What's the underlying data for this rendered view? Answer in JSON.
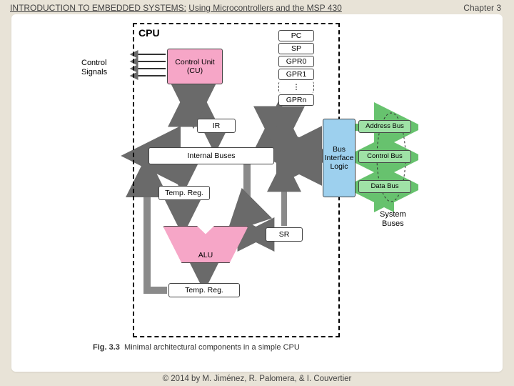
{
  "header": {
    "title_left": "INTRODUCTION TO EMBEDDED SYSTEMS:",
    "title_right": "Using Microcontrollers and the MSP 430",
    "chapter": "Chapter 3"
  },
  "footer": {
    "copyright": "© 2014 by M. Jiménez, R. Palomera, & I. Couvertier"
  },
  "caption": {
    "fig_label": "Fig. 3.3",
    "text": "Minimal architectural components in a simple CPU"
  },
  "labels": {
    "cpu": "CPU",
    "control_signals_l1": "Control",
    "control_signals_l2": "Signals",
    "cu_l1": "Control Unit",
    "cu_l2": "(CU)",
    "pc": "PC",
    "sp": "SP",
    "gpr0": "GPR0",
    "gpr1": "GPR1",
    "gpr_ell": "⋮",
    "gprn": "GPRn",
    "ir": "IR",
    "internal_buses": "Internal Buses",
    "temp_reg": "Temp. Reg.",
    "alu": "ALU",
    "sr": "SR",
    "bus_if_l1": "Bus",
    "bus_if_l2": "Interface",
    "bus_if_l3": "Logic",
    "addr_bus": "Address Bus",
    "ctrl_bus": "Control Bus",
    "data_bus": "Data Bus",
    "system_buses_l1": "System",
    "system_buses_l2": "Buses"
  }
}
